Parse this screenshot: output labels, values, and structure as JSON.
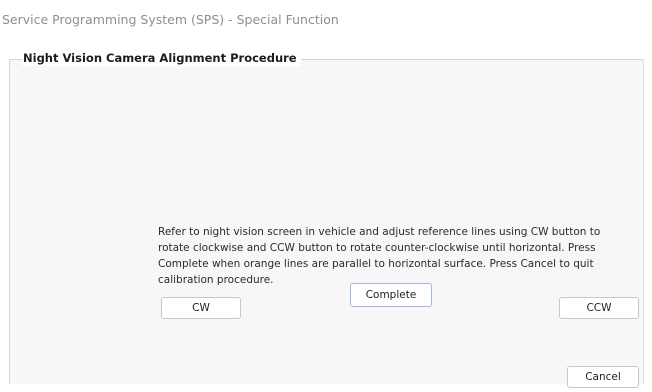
{
  "window": {
    "title": "Service Programming System (SPS) - Special Function"
  },
  "panel": {
    "title": "Night Vision Camera Alignment Procedure"
  },
  "instructions": {
    "text": "Refer to night vision screen in vehicle and adjust reference lines using CW button to rotate clockwise and CCW button to rotate counter-clockwise until horizontal. Press Complete when orange lines are parallel to horizontal surface. Press Cancel to quit calibration procedure."
  },
  "buttons": {
    "cw": "CW",
    "complete": "Complete",
    "ccw": "CCW",
    "cancel": "Cancel"
  },
  "colors": {
    "title_text": "#8f8f8f",
    "panel_background": "#f7f7f7",
    "focused_button_border": "#9fb9d6"
  }
}
